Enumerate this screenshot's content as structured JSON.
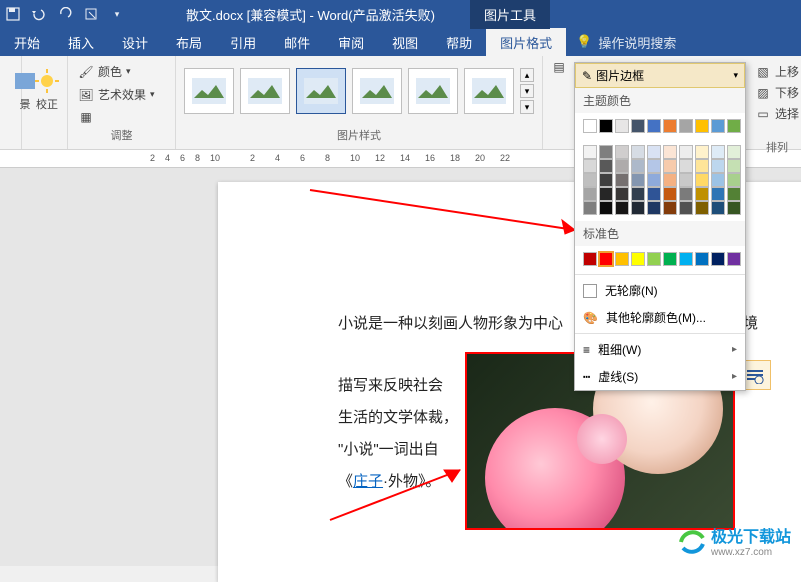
{
  "titlebar": {
    "doc_title": "散文.docx [兼容模式] - Word(产品激活失败)",
    "tool_tab": "图片工具"
  },
  "tabs": {
    "items": [
      "开始",
      "插入",
      "设计",
      "布局",
      "引用",
      "邮件",
      "审阅",
      "视图",
      "帮助",
      "图片格式"
    ],
    "active_index": 9,
    "help_hint": "操作说明搜索"
  },
  "ribbon": {
    "group1": {
      "bg_label": "景",
      "correct_label": "校正",
      "group_name": "调整",
      "color_label": "颜色",
      "artistic_label": "艺术效果"
    },
    "group2": {
      "group_name": "图片样式"
    },
    "border_btn": "图片边框",
    "arrange": {
      "up": "上移",
      "down": "下移",
      "select": "选择",
      "group_name": "排列"
    }
  },
  "ruler": {
    "left": [
      "10",
      "8",
      "6",
      "4",
      "2"
    ],
    "right": [
      "2",
      "4",
      "6",
      "8",
      "10",
      "12",
      "14",
      "16",
      "18",
      "20",
      "22"
    ]
  },
  "color_popup": {
    "theme_title": "主题颜色",
    "standard_title": "标准色",
    "no_outline": "无轮廓(N)",
    "more_colors": "其他轮廓颜色(M)...",
    "weight": "粗细(W)",
    "dashes": "虚线(S)",
    "theme_row1": [
      "#ffffff",
      "#000000",
      "#e7e6e6",
      "#44546a",
      "#4472c4",
      "#ed7d31",
      "#a5a5a5",
      "#ffc000",
      "#5b9bd5",
      "#70ad47"
    ],
    "theme_shades": [
      [
        "#f2f2f2",
        "#7f7f7f",
        "#d0cece",
        "#d6dce4",
        "#d9e2f3",
        "#fbe5d5",
        "#ededed",
        "#fff2cc",
        "#deebf6",
        "#e2efd9"
      ],
      [
        "#d8d8d8",
        "#595959",
        "#aeabab",
        "#adb9ca",
        "#b4c6e7",
        "#f7cbac",
        "#dbdbdb",
        "#fee599",
        "#bdd7ee",
        "#c5e0b3"
      ],
      [
        "#bfbfbf",
        "#3f3f3f",
        "#757070",
        "#8496b0",
        "#8eaadb",
        "#f4b183",
        "#c9c9c9",
        "#ffd965",
        "#9cc3e5",
        "#a8d08d"
      ],
      [
        "#a5a5a5",
        "#262626",
        "#3a3838",
        "#323f4f",
        "#2f5496",
        "#c55a11",
        "#7b7b7b",
        "#bf9000",
        "#2e75b5",
        "#538135"
      ],
      [
        "#7f7f7f",
        "#0c0c0c",
        "#171616",
        "#222a35",
        "#1f3864",
        "#833c0b",
        "#525252",
        "#7f6000",
        "#1e4e79",
        "#375623"
      ]
    ],
    "standard": [
      "#c00000",
      "#ff0000",
      "#ffc000",
      "#ffff00",
      "#92d050",
      "#00b050",
      "#00b0f0",
      "#0070c0",
      "#002060",
      "#7030a0"
    ],
    "selected_standard_index": 1
  },
  "document": {
    "line1": "小说是一种以刻画人物形象为中心",
    "line1_tail": "环境",
    "line2": "描写来反映社会",
    "line3": "生活的文学体裁，",
    "line4a": "\"小说\"一词出自",
    "line5a": "《",
    "line5_link": "庄子",
    "line5b": "·外物》。"
  },
  "watermark": {
    "brand": "极光下载站",
    "url": "www.xz7.com"
  }
}
